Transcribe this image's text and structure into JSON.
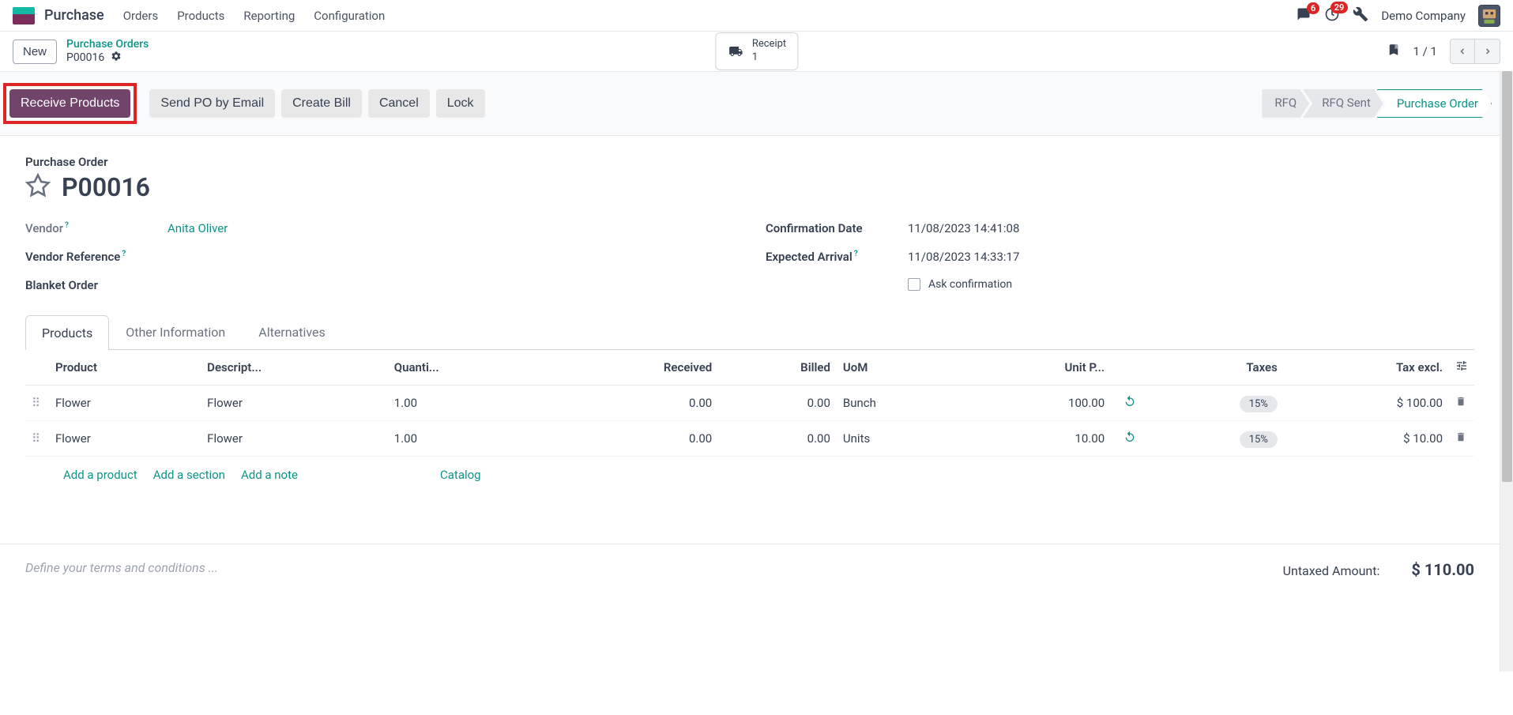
{
  "app": {
    "name": "Purchase"
  },
  "nav": [
    "Orders",
    "Products",
    "Reporting",
    "Configuration"
  ],
  "topbar": {
    "messages_badge": "6",
    "activities_badge": "29",
    "company": "Demo Company"
  },
  "header": {
    "new_btn": "New",
    "breadcrumb_link": "Purchase Orders",
    "breadcrumb_current": "P00016",
    "receipt_label": "Receipt",
    "receipt_count": "1",
    "pager": "1 / 1"
  },
  "actions": {
    "receive": "Receive Products",
    "send_po": "Send PO by Email",
    "create_bill": "Create Bill",
    "cancel": "Cancel",
    "lock": "Lock"
  },
  "status": {
    "rfq": "RFQ",
    "rfq_sent": "RFQ Sent",
    "purchase_order": "Purchase Order"
  },
  "form": {
    "title_label": "Purchase Order",
    "title": "P00016",
    "vendor_label": "Vendor",
    "vendor_value": "Anita Oliver",
    "vendor_ref_label": "Vendor Reference",
    "blanket_label": "Blanket Order",
    "confirm_date_label": "Confirmation Date",
    "confirm_date_value": "11/08/2023 14:41:08",
    "expected_label": "Expected Arrival",
    "expected_value": "11/08/2023 14:33:17",
    "ask_confirm": "Ask confirmation"
  },
  "tabs": {
    "products": "Products",
    "other": "Other Information",
    "alternatives": "Alternatives"
  },
  "table": {
    "headers": {
      "product": "Product",
      "description": "Descript...",
      "quantity": "Quanti...",
      "received": "Received",
      "billed": "Billed",
      "uom": "UoM",
      "unit_price": "Unit P...",
      "taxes": "Taxes",
      "tax_excl": "Tax excl."
    },
    "rows": [
      {
        "product": "Flower",
        "description": "Flower",
        "quantity": "1.00",
        "received": "0.00",
        "billed": "0.00",
        "uom": "Bunch",
        "unit_price": "100.00",
        "taxes": "15%",
        "tax_excl": "$ 100.00"
      },
      {
        "product": "Flower",
        "description": "Flower",
        "quantity": "1.00",
        "received": "0.00",
        "billed": "0.00",
        "uom": "Units",
        "unit_price": "10.00",
        "taxes": "15%",
        "tax_excl": "$ 10.00"
      }
    ],
    "add_product": "Add a product",
    "add_section": "Add a section",
    "add_note": "Add a note",
    "catalog": "Catalog"
  },
  "footer": {
    "terms_placeholder": "Define your terms and conditions ...",
    "untaxed_label": "Untaxed Amount:",
    "untaxed_value": "$ 110.00"
  }
}
